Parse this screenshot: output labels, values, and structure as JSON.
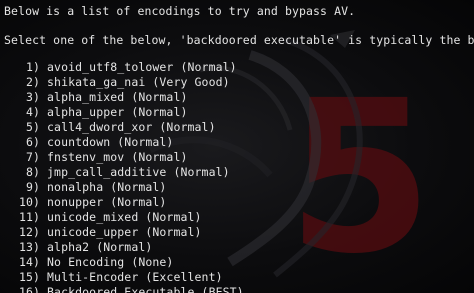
{
  "terminal": {
    "intro": "Below is a list of encodings to try and bypass AV.",
    "prompt": "Select one of the below, 'backdoored executable' is typically the best.",
    "options": [
      {
        "num": "1)",
        "text": "avoid_utf8_tolower (Normal)"
      },
      {
        "num": "2)",
        "text": "shikata_ga_nai (Very Good)"
      },
      {
        "num": "3)",
        "text": "alpha_mixed (Normal)"
      },
      {
        "num": "4)",
        "text": "alpha_upper (Normal)"
      },
      {
        "num": "5)",
        "text": "call4_dword_xor (Normal)"
      },
      {
        "num": "6)",
        "text": "countdown (Normal)"
      },
      {
        "num": "7)",
        "text": "fnstenv_mov (Normal)"
      },
      {
        "num": "8)",
        "text": "jmp_call_additive (Normal)"
      },
      {
        "num": "9)",
        "text": "nonalpha (Normal)"
      },
      {
        "num": "10)",
        "text": "nonupper (Normal)"
      },
      {
        "num": "11)",
        "text": "unicode_mixed (Normal)"
      },
      {
        "num": "12)",
        "text": "unicode_upper (Normal)"
      },
      {
        "num": "13)",
        "text": "alpha2 (Normal)"
      },
      {
        "num": "14)",
        "text": "No Encoding (None)"
      },
      {
        "num": "15)",
        "text": "Multi-Encoder (Excellent)"
      },
      {
        "num": "16)",
        "text": "Backdoored Executable (BEST)"
      }
    ]
  },
  "colors": {
    "background": "#0a0a0b",
    "text": "#e4e4e4",
    "wallpaper_accent": "#6a0f12"
  }
}
